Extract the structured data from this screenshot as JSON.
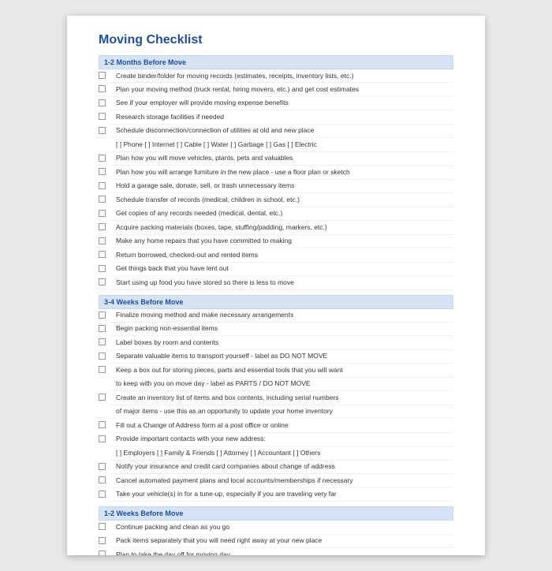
{
  "title": "Moving Checklist",
  "sections": [
    {
      "header": "1-2 Months Before Move",
      "items": [
        {
          "c": true,
          "t": "Create binder/folder for moving records (estimates, receipts, inventory lists, etc.)"
        },
        {
          "c": true,
          "t": "Plan your moving method (truck rental, hiring movers, etc.) and get cost estimates"
        },
        {
          "c": true,
          "t": "See if your employer will provide moving expense benefits"
        },
        {
          "c": true,
          "t": "Research storage facilities if needed"
        },
        {
          "c": true,
          "t": "Schedule disconnection/connection of utilities at old and new place"
        },
        {
          "c": false,
          "t": "[  ] Phone   [  ] Internet   [  ] Cable   [  ] Water   [  ] Garbage   [  ] Gas   [  ] Electric"
        },
        {
          "c": true,
          "t": "Plan how you will move vehicles, plants, pets and valuables"
        },
        {
          "c": true,
          "t": "Plan how you will arrange furniture in the new place - use a floor plan or sketch"
        },
        {
          "c": true,
          "t": "Hold a garage sale, donate, sell, or trash unnecessary items"
        },
        {
          "c": true,
          "t": "Schedule transfer of records (medical, children in school, etc.)"
        },
        {
          "c": true,
          "t": "Get copies of any records needed (medical, dental, etc.)"
        },
        {
          "c": true,
          "t": "Acquire packing materials (boxes, tape, stuffing/padding, markers, etc.)"
        },
        {
          "c": true,
          "t": "Make any home repairs that you have committed to making"
        },
        {
          "c": true,
          "t": "Return borrowed, checked-out and rented items"
        },
        {
          "c": true,
          "t": "Get things back that you have lent out"
        },
        {
          "c": true,
          "t": "Start using up food you have stored so there is less to move"
        }
      ]
    },
    {
      "header": "3-4 Weeks Before Move",
      "items": [
        {
          "c": true,
          "t": "Finalize moving method and make necessary arrangements"
        },
        {
          "c": true,
          "t": "Begin packing non-essential items"
        },
        {
          "c": true,
          "t": "Label boxes by room and contents"
        },
        {
          "c": true,
          "t": "Separate valuable items to transport yourself - label as DO NOT MOVE"
        },
        {
          "c": true,
          "t": "Keep a box out for storing pieces, parts and essential tools that you will want"
        },
        {
          "c": false,
          "t": "to keep with you on move day - label as PARTS / DO NOT MOVE"
        },
        {
          "c": true,
          "t": "Create an inventory list of items and box contents, including serial numbers"
        },
        {
          "c": false,
          "t": "of major items - use this as an opportunity to update your home inventory"
        },
        {
          "c": true,
          "t": "Fill out a Change of Address form at a post office or online"
        },
        {
          "c": true,
          "t": "Provide important contacts with your new address:"
        },
        {
          "c": false,
          "t": "[  ] Employers   [  ] Family & Friends   [  ] Attorney   [  ] Accountant   [  ] Others"
        },
        {
          "c": true,
          "t": "Notify your insurance and credit card companies about change of address"
        },
        {
          "c": true,
          "t": "Cancel automated payment plans and local accounts/memberships if necessary"
        },
        {
          "c": true,
          "t": "Take your vehicle(s) in for a tune-up, especially if you are traveling very far"
        }
      ]
    },
    {
      "header": "1-2 Weeks Before Move",
      "items": [
        {
          "c": true,
          "t": "Continue packing and clean as you go"
        },
        {
          "c": true,
          "t": "Pack items separately that you will need right away at your new place"
        },
        {
          "c": true,
          "t": "Plan to take the day off for moving day"
        }
      ]
    }
  ]
}
